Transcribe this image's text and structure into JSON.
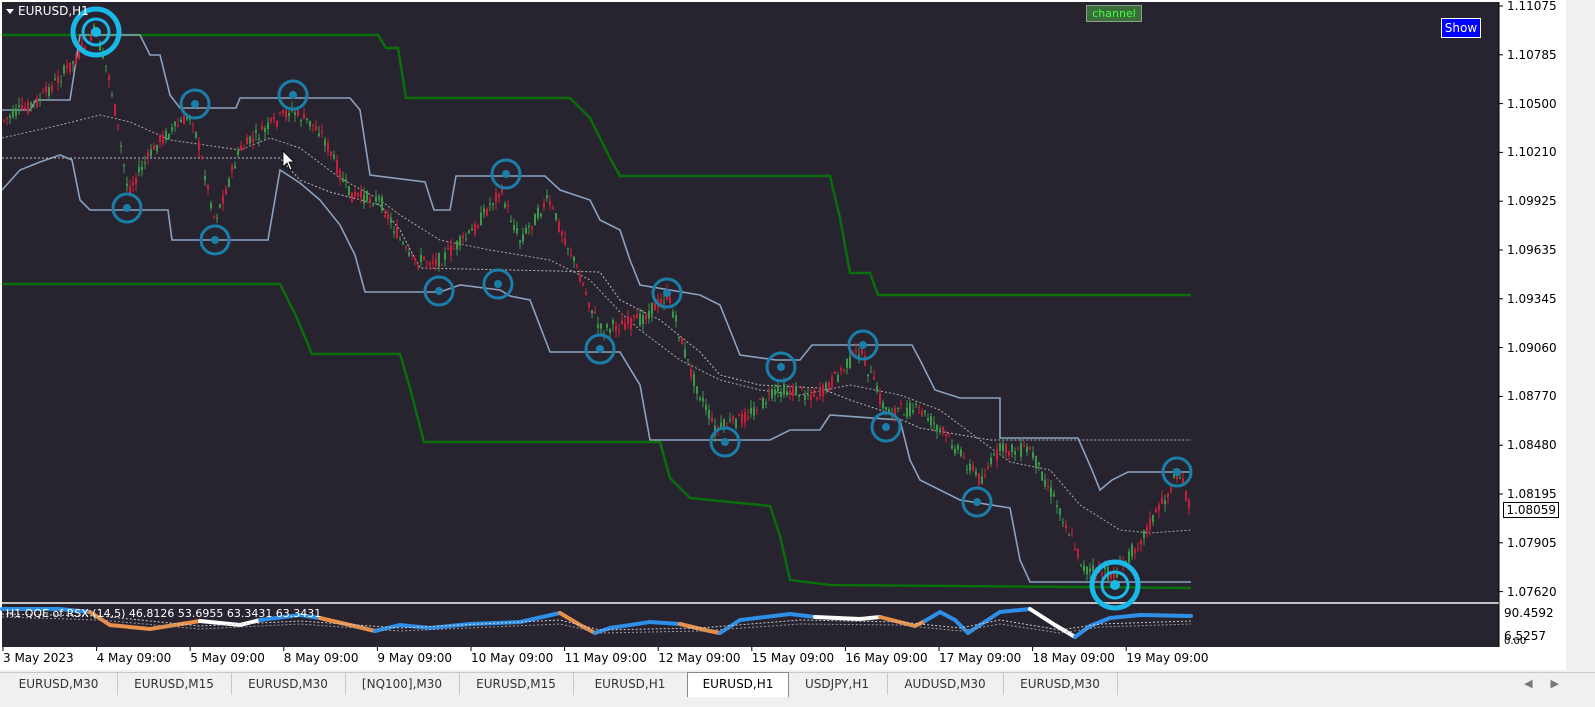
{
  "chart": {
    "symbol_title": "EURUSD,H1",
    "channel_label": "channel",
    "show_button": "Show",
    "current_price": "1.08059",
    "price_axis": [
      "1.11075",
      "1.10785",
      "1.10500",
      "1.10210",
      "1.09925",
      "1.09635",
      "1.09345",
      "1.09060",
      "1.08770",
      "1.08480",
      "1.08195",
      "1.07905",
      "1.07620"
    ],
    "time_axis": [
      "3 May 2023",
      "4 May 09:00",
      "5 May 09:00",
      "8 May 09:00",
      "9 May 09:00",
      "10 May 09:00",
      "11 May 09:00",
      "12 May 09:00",
      "15 May 09:00",
      "16 May 09:00",
      "17 May 09:00",
      "18 May 09:00",
      "19 May 09:00"
    ],
    "colors": {
      "background": "#27232f",
      "candle_up": "#3a9a4a",
      "candle_down": "#c8203a",
      "outer_channel": "#0a6e0a",
      "inner_channel": "#8aa2c0",
      "marker": "#1a7ea8",
      "marker_big": "#1ab8e8"
    }
  },
  "indicator": {
    "title": "H1 QQE of RSX (14,5) 46.8126 53.6955 63.3431 63.3431",
    "scale_top": "90.4592",
    "scale_mid": "6.5257",
    "scale_bottom": "0.00",
    "colors": {
      "bull": "#2e8fe8",
      "bear": "#e8904a",
      "neutral": "#ffffff"
    }
  },
  "tabs": [
    {
      "label": "EURUSD,M30",
      "active": false
    },
    {
      "label": "EURUSD,M15",
      "active": false
    },
    {
      "label": "EURUSD,M30",
      "active": false
    },
    {
      "label": "[NQ100],M30",
      "active": false
    },
    {
      "label": "EURUSD,M15",
      "active": false
    },
    {
      "label": "EURUSD,H1",
      "active": false
    },
    {
      "label": "EURUSD,H1",
      "active": true
    },
    {
      "label": "USDJPY,H1",
      "active": false
    },
    {
      "label": "AUDUSD,M30",
      "active": false
    },
    {
      "label": "EURUSD,M30",
      "active": false
    }
  ],
  "tab_nav": {
    "prev": "◀",
    "next": "▶"
  }
}
